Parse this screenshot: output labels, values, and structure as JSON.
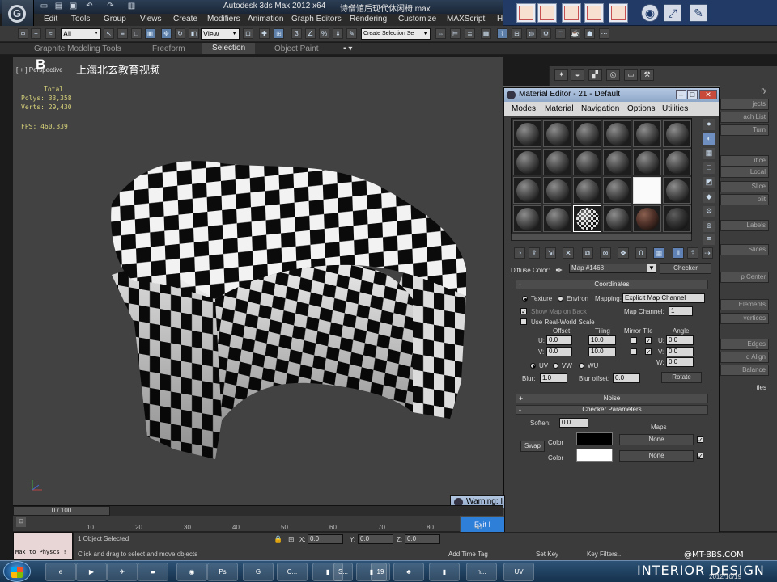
{
  "app": {
    "title": "Autodesk 3ds Max  2012 x64",
    "filename": "诗僧馆后现代休闲椅.max"
  },
  "menus": [
    "Edit",
    "Tools",
    "Group",
    "Views",
    "Create",
    "Modifiers",
    "Animation",
    "Graph Editors",
    "Rendering",
    "Customize",
    "MAXScript",
    "H"
  ],
  "toolbar": {
    "selection_filter": "All",
    "ref_coord": "View",
    "named_selection": "Create Selection Se"
  },
  "ribbon_tabs": [
    "Graphite Modeling Tools",
    "Freeform",
    "Selection",
    "Object Paint"
  ],
  "viewport": {
    "label": "[ + ] Perspective",
    "stats_total": "Total",
    "polys": "Polys:  33,358",
    "verts": "Verts:  29,430",
    "fps": "FPS:    460.339",
    "watermark": "上海北玄教育视频"
  },
  "material_editor": {
    "title": "Material Editor - 21 - Default",
    "menus": [
      "Modes",
      "Material",
      "Navigation",
      "Options",
      "Utilities"
    ],
    "diffuse_label": "Diffuse Color:",
    "map_name": "Map #1468",
    "map_type": "Checker",
    "coordinates": {
      "header": "Coordinates",
      "texture": "Texture",
      "environ": "Environ",
      "mapping_label": "Mapping:",
      "mapping_value": "Explicit Map Channel",
      "show_map": "Show Map on Back",
      "map_channel_label": "Map Channel:",
      "map_channel": "1",
      "real_world": "Use Real-World Scale",
      "offset": "Offset",
      "tiling": "Tiling",
      "mirror_tile": "Mirror Tile",
      "angle": "Angle",
      "u_label": "U:",
      "v_label": "V:",
      "w_label": "W:",
      "offset_u": "0.0",
      "offset_v": "0.0",
      "tiling_u": "10.0",
      "tiling_v": "10.0",
      "angle_u": "0.0",
      "angle_v": "0.0",
      "angle_w": "0.0",
      "uv": "UV",
      "vw": "VW",
      "wu": "WU",
      "blur_label": "Blur:",
      "blur": "1.0",
      "blur_offset_label": "Blur offset:",
      "blur_offset": "0.0",
      "rotate": "Rotate"
    },
    "noise_header": "Noise",
    "checker": {
      "header": "Checker Parameters",
      "soften_label": "Soften:",
      "soften": "0.0",
      "maps_label": "Maps",
      "swap": "Swap",
      "color_label": "Color",
      "color1": "#000000",
      "color2": "#ffffff",
      "none1": "None",
      "none2": "None"
    }
  },
  "command_panel": {
    "labels": [
      "ry",
      "jects",
      "ach List",
      "Turn",
      "ifice",
      "Local",
      "Slice",
      "plit",
      "Labels",
      "Slices",
      "p Center",
      "Elements",
      "vertices",
      "Edges",
      "d Align",
      "Balance",
      "ties"
    ]
  },
  "warning": {
    "title": "Warning: I",
    "button": "Exit I"
  },
  "timeline": {
    "slider": "0 / 100",
    "ticks": [
      "10",
      "20",
      "30",
      "40",
      "50",
      "60",
      "70",
      "80",
      "90"
    ]
  },
  "status": {
    "selected": "1 Object Selected",
    "prompt": "Click and drag to select and move objects",
    "x_label": "X:",
    "x": "0.0",
    "y_label": "Y:",
    "y": "0.0",
    "z_label": "Z:",
    "z": "0.0",
    "add_time_tag": "Add Time Tag",
    "set_key": "Set Key",
    "key_filters": "Key Filters..."
  },
  "maxscript": {
    "line": "Max to Physcs !"
  },
  "taskbar": {
    "items": [
      "",
      "",
      "",
      "",
      "",
      "",
      "C...",
      "",
      "S...",
      "",
      "19",
      "",
      "h...",
      "",
      "UV"
    ]
  },
  "watermarks": {
    "site": "@MT-BBS.COM",
    "brand": "INTERIOR DESIGN",
    "date": "2012/10/19"
  },
  "colors": {
    "viewport_bg": "#424242",
    "accent": "#5f81b4",
    "title_bar": "#8fa7c8"
  }
}
